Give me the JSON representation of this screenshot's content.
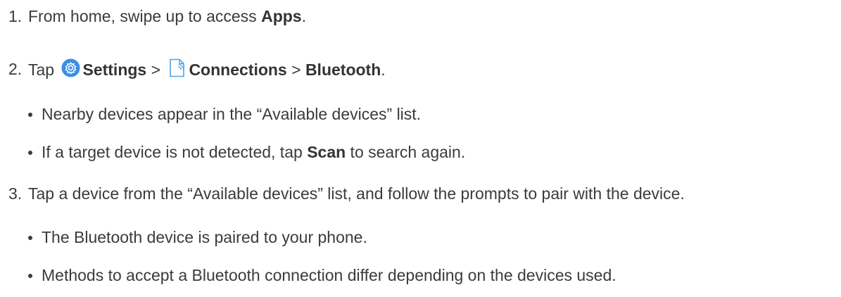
{
  "steps": [
    {
      "number": "1.",
      "parts": [
        "From home, swipe up to access ",
        "Apps",
        "."
      ]
    },
    {
      "number": "2.",
      "parts": [
        "Tap ",
        "Settings",
        " > ",
        "Connections",
        " > ",
        "Bluetooth",
        "."
      ],
      "icons": [
        "settings-gear-icon",
        "connections-icon"
      ],
      "bullets": [
        {
          "parts": [
            "Nearby devices appear in the “Available devices” list."
          ]
        },
        {
          "parts": [
            "If a target device is not detected, tap ",
            "Scan",
            " to search again."
          ]
        }
      ]
    },
    {
      "number": "3.",
      "parts": [
        "Tap a device from the “Available devices” list, and follow the prompts to pair with the device."
      ],
      "bullets": [
        {
          "parts": [
            "The Bluetooth device is paired to your phone."
          ]
        },
        {
          "parts": [
            "Methods to accept a Bluetooth connection differ depending on the devices used."
          ]
        }
      ]
    }
  ],
  "colors": {
    "text": "#3b3b3b",
    "settings_icon_blue": "#3a8ee6",
    "connections_icon_blue": "#4aa3ea"
  }
}
